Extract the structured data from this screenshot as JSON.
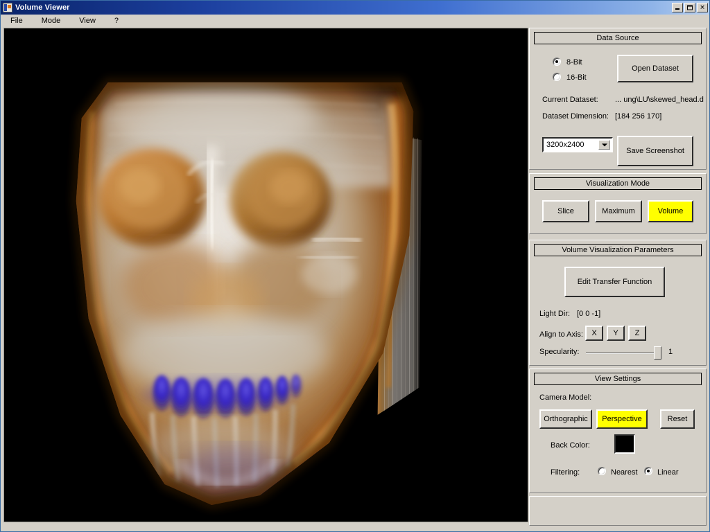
{
  "window": {
    "title": "Volume Viewer",
    "icon": "app-icon",
    "buttons": {
      "minimize": "_",
      "maximize": "□",
      "close": "✕"
    }
  },
  "menu": {
    "items": [
      {
        "label": "File"
      },
      {
        "label": "Mode"
      },
      {
        "label": "View"
      },
      {
        "label": "?"
      }
    ]
  },
  "viewport": {
    "background_color": "#000000",
    "render_description": "Volume-rendered skewed human head dataset: orange-tan bone, gray soft tissue, blue dental structures"
  },
  "panels": {
    "data_source": {
      "title": "Data Source",
      "bit_depth": {
        "options": [
          "8-Bit",
          "16-Bit"
        ],
        "selected": "8-Bit"
      },
      "open_dataset_label": "Open Dataset",
      "current_dataset_label": "Current Dataset:",
      "current_dataset_value": "... ung\\LU\\skewed_head.d",
      "dataset_dimension_label": "Dataset Dimension:",
      "dataset_dimension_value": "[184 256 170]",
      "resolution": {
        "selected": "3200x2400",
        "options": [
          "3200x2400"
        ]
      },
      "save_screenshot_label": "Save Screenshot"
    },
    "visualization_mode": {
      "title": "Visualization Mode",
      "modes": [
        {
          "label": "Slice",
          "active": false
        },
        {
          "label": "Maximum",
          "active": false
        },
        {
          "label": "Volume",
          "active": true
        }
      ],
      "active_color": "#ffff00"
    },
    "volume_parameters": {
      "title": "Volume Visualization Parameters",
      "edit_transfer_function_label": "Edit Transfer Function",
      "light_dir_label": "Light Dir:",
      "light_dir_value": "[0 0 -1]",
      "align_to_axis_label": "Align to Axis:",
      "axis_buttons": [
        "X",
        "Y",
        "Z"
      ],
      "specularity_label": "Specularity:",
      "specularity_value": "1"
    },
    "view_settings": {
      "title": "View Settings",
      "camera_model_label": "Camera Model:",
      "camera_buttons": [
        {
          "label": "Orthographic",
          "active": false
        },
        {
          "label": "Perspective",
          "active": true
        },
        {
          "label": "Reset",
          "active": false
        }
      ],
      "back_color_label": "Back Color:",
      "back_color_value": "#000000",
      "filtering_label": "Filtering:",
      "filtering": {
        "options": [
          "Nearest",
          "Linear"
        ],
        "selected": "Linear"
      }
    }
  }
}
